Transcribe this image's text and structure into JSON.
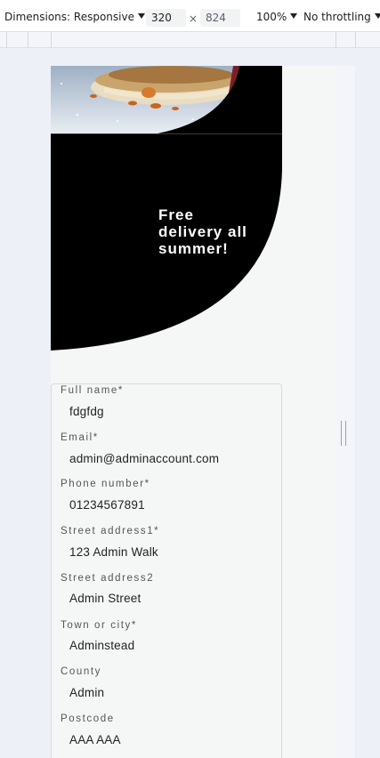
{
  "devtools": {
    "dimensions_label": "Dimensions: Responsive",
    "width_value": "320",
    "height_value": "824",
    "times_sign": "×",
    "zoom_label": "100%",
    "throttle_label": "No throttling"
  },
  "promo": {
    "text": "Free delivery all summer!"
  },
  "form": {
    "fields": [
      {
        "label": "Full name*",
        "value": "fdgfdg"
      },
      {
        "label": "Email*",
        "value": "admin@adminaccount.com"
      },
      {
        "label": "Phone number*",
        "value": "01234567891"
      },
      {
        "label": "Street address1*",
        "value": "123 Admin Walk"
      },
      {
        "label": "Street address2",
        "value": "Admin Street"
      },
      {
        "label": "Town or city*",
        "value": "Adminstead"
      },
      {
        "label": "County",
        "value": "Admin"
      },
      {
        "label": "Postcode",
        "value": "AAA AAA"
      }
    ]
  },
  "colors": {
    "promo_background": "#000000",
    "page_background": "#f5f7f7",
    "devtools_background": "#eef0f8"
  }
}
